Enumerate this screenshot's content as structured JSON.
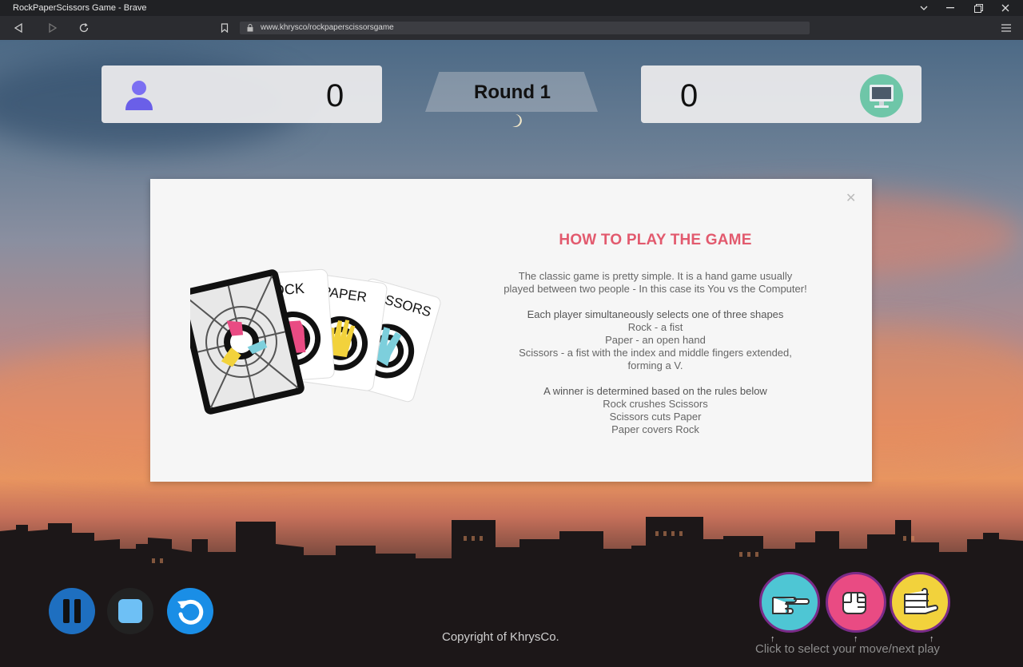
{
  "window": {
    "title": "RockPaperScissors Game - Brave",
    "url": "www.khrysco/rockpaperscissorsgame"
  },
  "scoreboard": {
    "player_score": "0",
    "computer_score": "0",
    "round_label": "Round 1"
  },
  "modal": {
    "title": "HOW TO PLAY THE GAME",
    "intro": "The classic game is pretty simple. It is a hand game usually played between two people - In this case its You vs the Computer!",
    "shapes_heading": "Each player simultaneously selects one of three shapes",
    "shapes": [
      "Rock - a fist",
      "Paper - an open hand",
      "Scissors - a fist with the index and middle fingers extended, forming a V."
    ],
    "rules_heading": "A winner is determined based on the rules below",
    "rules": [
      "Rock crushes Scissors",
      "Scissors cuts Paper",
      "Paper covers Rock"
    ],
    "cards": [
      "ROCK",
      "PAPER",
      "SSORS"
    ]
  },
  "footer": {
    "copyright": "Copyright  of KhrysCo.",
    "hint": "Click to select your move/next play",
    "arrow": "↑"
  },
  "colors": {
    "accent_title": "#e25a6e",
    "pause": "#1e6fc0",
    "restart": "#1a8ee6",
    "move_scissors": "#4ec6d4",
    "move_rock": "#e94b83",
    "move_paper": "#f2d23c"
  }
}
